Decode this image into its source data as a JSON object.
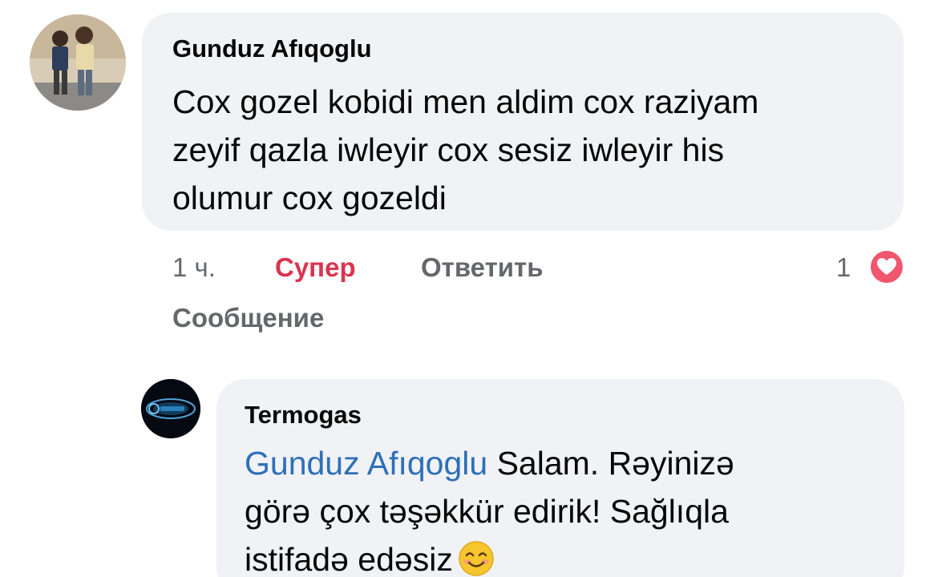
{
  "comment": {
    "author": "Gunduz Afıqoglu",
    "lines": [
      "Cox gozel kobidi men aldim cox raziyam",
      "zeyif qazla iwleyir cox sesiz iwleyir his",
      "olumur cox gozeldi"
    ],
    "actions": {
      "time": "1 ч.",
      "reaction_label": "Супер",
      "reply_label": "Ответить",
      "message_label": "Сообщение"
    },
    "reaction_count": "1",
    "reaction_icon": "heart-icon",
    "colors": {
      "reaction": "#d9344f",
      "bubble": "#f0f2f5",
      "secondary_text": "#65676b"
    }
  },
  "reply": {
    "author": "Termogas",
    "mention": "Gunduz Afıqoglu",
    "line1_rest": " Salam. Rəyinizə",
    "line2": "görə çox təşəkkür edirik! Sağlıqla",
    "line3": "istifadə edəsiz",
    "emoji_icon": "smiling-face-emoji-icon",
    "colors": {
      "mention": "#2e6fb8"
    }
  }
}
